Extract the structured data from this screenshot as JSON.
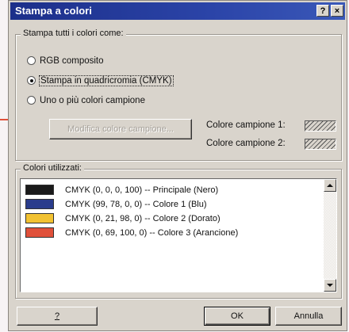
{
  "window": {
    "title": "Stampa a colori",
    "help_label": "?",
    "close_label": "×",
    "title_color": "#1c2f8a"
  },
  "print_group": {
    "legend": "Stampa tutti i colori come:",
    "options": [
      {
        "label": "RGB composito",
        "selected": false
      },
      {
        "label": "Stampa in quadricromia (CMYK)",
        "selected": true
      },
      {
        "label": "Uno o più colori campione",
        "selected": false
      }
    ],
    "edit_button": "Modifica colore campione...",
    "spot1_label": "Colore campione 1:",
    "spot2_label": "Colore campione 2:"
  },
  "colors_group": {
    "legend": "Colori utilizzati:",
    "items": [
      {
        "swatch": "#1a1a1a",
        "text": "CMYK (0, 0, 0, 100)  --  Principale (Nero)"
      },
      {
        "swatch": "#2a3c8c",
        "text": "CMYK (99, 78, 0, 0)  --  Colore 1 (Blu)"
      },
      {
        "swatch": "#f2c232",
        "text": "CMYK (0, 21, 98, 0)  --  Colore 2 (Dorato)"
      },
      {
        "swatch": "#e0503a",
        "text": "CMYK (0, 69, 100, 0)  --  Colore 3 (Arancione)"
      }
    ]
  },
  "footer": {
    "help_button": "?",
    "ok_button": "OK",
    "cancel_button": "Annulla"
  },
  "icons": {
    "scroll_up": "arrow-up-icon",
    "scroll_down": "arrow-down-icon",
    "hatched_swatch": "hatch-pattern"
  }
}
